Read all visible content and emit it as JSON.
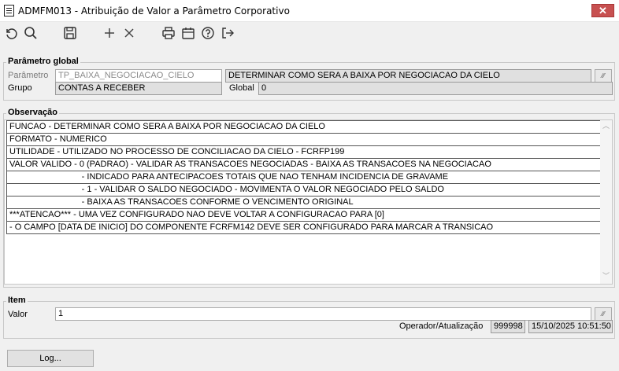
{
  "window": {
    "title": "ADMFM013 - Atribuição de Valor a Parâmetro Corporativo",
    "close_label": "✕"
  },
  "toolbar": {
    "icons": [
      "undo-icon",
      "search-icon",
      "save-icon",
      "add-icon",
      "delete-icon",
      "print-icon",
      "calendar-icon",
      "help-icon",
      "exit-icon"
    ]
  },
  "parametro_global": {
    "section_title": "Parâmetro global",
    "parametro_label": "Parâmetro",
    "parametro_value": "TP_BAIXA_NEGOCIACAO_CIELO",
    "descricao_value": "DETERMINAR COMO SERA A BAIXA POR NEGOCIACAO DA CIELO",
    "grupo_label": "Grupo",
    "grupo_value": "CONTAS A RECEBER",
    "global_label": "Global",
    "global_value": "0",
    "lookup_glyph": "⁄⁄⁄"
  },
  "observacao": {
    "section_title": "Observação",
    "lines": [
      "FUNCAO - DETERMINAR COMO SERA A BAIXA POR NEGOCIACAO DA CIELO",
      "FORMATO - NUMERICO",
      "UTILIDADE - UTILIZADO NO PROCESSO DE CONCILIACAO DA CIELO - FCRFP199",
      "VALOR VALIDO - 0 (PADRAO) - VALIDAR AS TRANSACOES NEGOCIADAS - BAIXA AS TRANSACOES NA NEGOCIACAO",
      "                              - INDICADO PARA ANTECIPACOES TOTAIS QUE NAO TENHAM INCIDENCIA DE GRAVAME",
      "                              - 1 - VALIDAR O SALDO NEGOCIADO - MOVIMENTA O VALOR NEGOCIADO PELO SALDO",
      "                              - BAIXA AS TRANSACOES CONFORME O VENCIMENTO ORIGINAL",
      "***ATENCAO*** - UMA VEZ CONFIGURADO NAO DEVE VOLTAR A CONFIGURACAO PARA [0]",
      "- O CAMPO [DATA DE INICIO] DO COMPONENTE FCRFM142 DEVE SER CONFIGURADO PARA MARCAR A TRANSICAO"
    ]
  },
  "item": {
    "section_title": "Item",
    "valor_label": "Valor",
    "valor_value": "1",
    "operador_label": "Operador/Atualização",
    "operador_value": "999998",
    "atualizacao_value": "15/10/2025 10:51:50",
    "lookup_glyph": "⁄⁄⁄"
  },
  "footer": {
    "log_button_label": "Log..."
  }
}
